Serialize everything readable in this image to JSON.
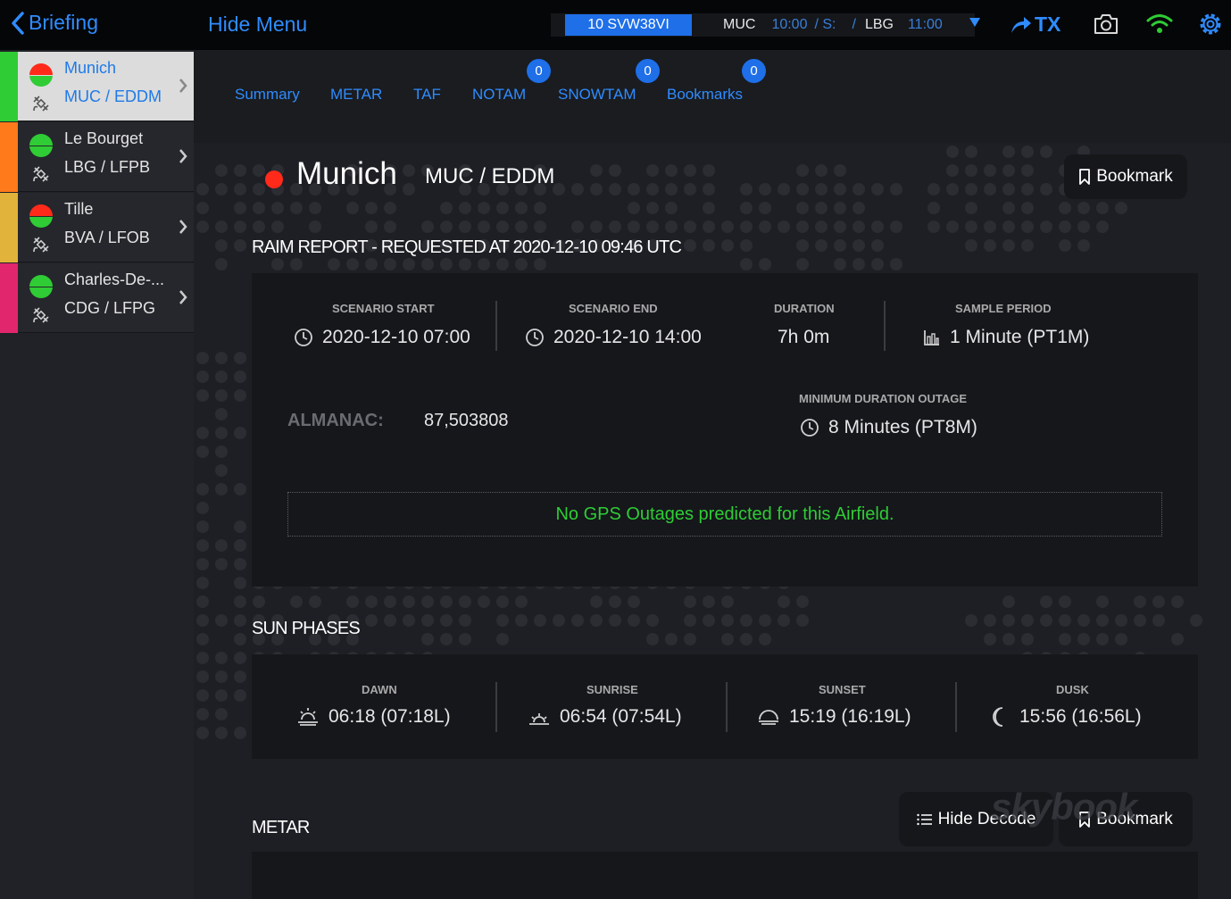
{
  "topbar": {
    "back_label": "Briefing",
    "hide_menu_label": "Hide Menu",
    "flight_id": "10 SVW38VI",
    "origin": "MUC",
    "origin_time": "10:00",
    "sep1": "/ S:",
    "sep2": "/",
    "destination": "LBG",
    "destination_time": "11:00",
    "tx_label": "TX",
    "accent_color": "#2f8cff"
  },
  "sidebar": {
    "airports": [
      {
        "name": "Munich",
        "code": "MUC / EDDM",
        "stripe_color": "#2fcc35",
        "active": true
      },
      {
        "name": "Le Bourget",
        "code": "LBG / LFPB",
        "stripe_color": "#ff7a1a",
        "active": false
      },
      {
        "name": "Tille",
        "code": "BVA / LFOB",
        "stripe_color": "#e2b33a",
        "active": false
      },
      {
        "name": "Charles-De-...",
        "code": "CDG / LFPG",
        "stripe_color": "#e2266e",
        "active": false
      }
    ]
  },
  "tabs": [
    {
      "label": "Summary"
    },
    {
      "label": "METAR"
    },
    {
      "label": "TAF"
    },
    {
      "label": "NOTAM",
      "badge": "0"
    },
    {
      "label": "SNOWTAM",
      "badge": "0"
    },
    {
      "label": "Bookmarks",
      "badge": "0"
    }
  ],
  "airport": {
    "title": "Munich",
    "codes": "MUC / EDDM",
    "status_color": "#ff2a1a",
    "bookmark_label": "Bookmark"
  },
  "raim": {
    "title": "RAIM REPORT - REQUESTED AT 2020-12-10 09:46 UTC",
    "scenario_start_label": "SCENARIO START",
    "scenario_start": "2020-12-10 07:00",
    "scenario_end_label": "SCENARIO END",
    "scenario_end": "2020-12-10 14:00",
    "duration_label": "DURATION",
    "duration": "7h 0m",
    "sample_period_label": "SAMPLE PERIOD",
    "sample_period": "1 Minute (PT1M)",
    "almanac_label": "ALMANAC:",
    "almanac": "87,503808",
    "min_outage_label": "MINIMUM DURATION OUTAGE",
    "min_outage": "8 Minutes (PT8M)",
    "outage_message": "No GPS Outages predicted for this Airfield."
  },
  "sun": {
    "title": "SUN PHASES",
    "dawn_label": "DAWN",
    "dawn": "06:18 (07:18L)",
    "sunrise_label": "SUNRISE",
    "sunrise": "06:54 (07:54L)",
    "sunset_label": "SUNSET",
    "sunset": "15:19 (16:19L)",
    "dusk_label": "DUSK",
    "dusk": "15:56 (16:56L)"
  },
  "metar": {
    "title": "METAR",
    "hide_decode_label": "Hide Decode",
    "bookmark_label": "Bookmark"
  },
  "watermark": "skybook"
}
